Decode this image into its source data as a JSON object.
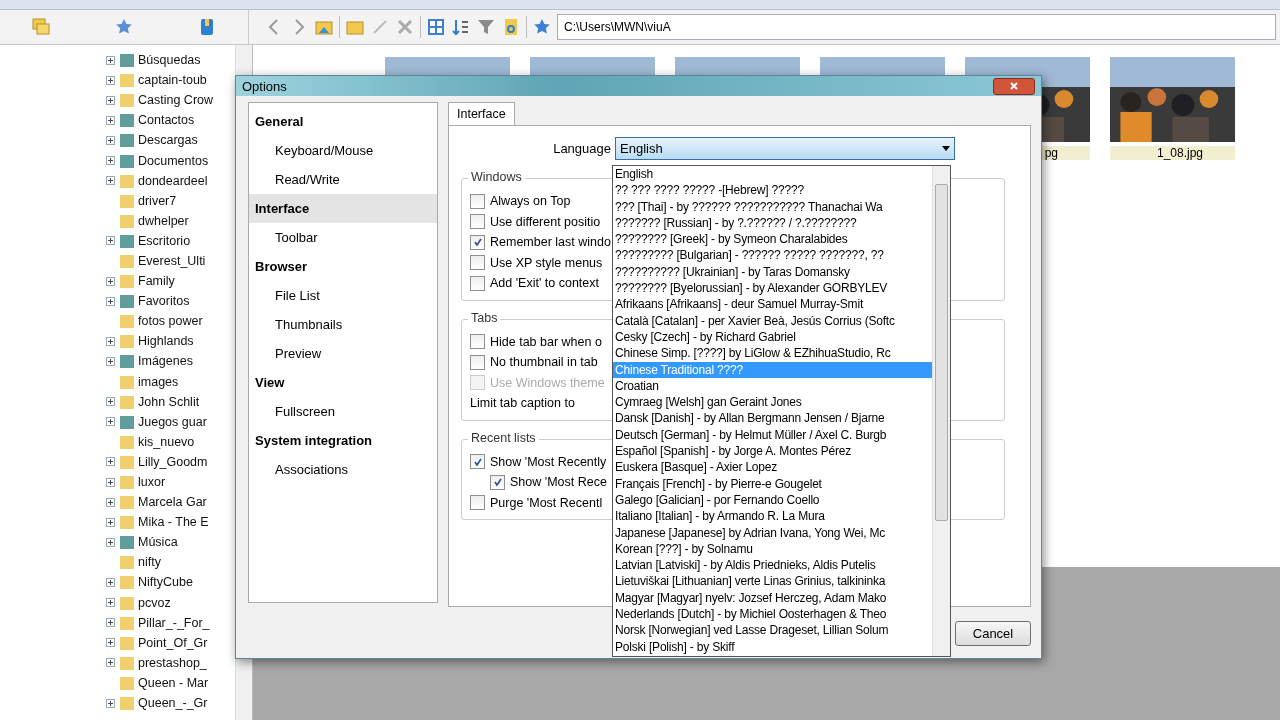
{
  "toolbar": {
    "path": "C:\\Users\\MWN\\viuA"
  },
  "tree": [
    {
      "label": "Búsquedas",
      "kind": "system",
      "expandable": true
    },
    {
      "label": "captain-toub",
      "kind": "folder",
      "expandable": true
    },
    {
      "label": "Casting Crow",
      "kind": "folder",
      "expandable": true
    },
    {
      "label": "Contactos",
      "kind": "system",
      "expandable": true
    },
    {
      "label": "Descargas",
      "kind": "system",
      "expandable": true
    },
    {
      "label": "Documentos",
      "kind": "system",
      "expandable": true
    },
    {
      "label": "dondeardeel",
      "kind": "folder",
      "expandable": true
    },
    {
      "label": "driver7",
      "kind": "folder",
      "expandable": false
    },
    {
      "label": "dwhelper",
      "kind": "folder",
      "expandable": false
    },
    {
      "label": "Escritorio",
      "kind": "system",
      "expandable": true
    },
    {
      "label": "Everest_Ulti",
      "kind": "folder",
      "expandable": false
    },
    {
      "label": "Family",
      "kind": "folder",
      "expandable": true
    },
    {
      "label": "Favoritos",
      "kind": "system",
      "expandable": true
    },
    {
      "label": "fotos power",
      "kind": "folder",
      "expandable": false
    },
    {
      "label": "Highlands",
      "kind": "folder",
      "expandable": true
    },
    {
      "label": "Imágenes",
      "kind": "system",
      "expandable": true
    },
    {
      "label": "images",
      "kind": "folder",
      "expandable": false
    },
    {
      "label": "John Schlit",
      "kind": "folder",
      "expandable": true
    },
    {
      "label": "Juegos guar",
      "kind": "system",
      "expandable": true
    },
    {
      "label": "kis_nuevo",
      "kind": "folder",
      "expandable": false
    },
    {
      "label": "Lilly_Goodm",
      "kind": "folder",
      "expandable": true
    },
    {
      "label": "luxor",
      "kind": "folder",
      "expandable": true
    },
    {
      "label": "Marcela Gar",
      "kind": "folder",
      "expandable": true
    },
    {
      "label": "Mika - The E",
      "kind": "folder",
      "expandable": true
    },
    {
      "label": "Música",
      "kind": "system",
      "expandable": true
    },
    {
      "label": "nifty",
      "kind": "folder",
      "expandable": false
    },
    {
      "label": "NiftyCube",
      "kind": "folder",
      "expandable": true
    },
    {
      "label": "pcvoz",
      "kind": "folder",
      "expandable": true
    },
    {
      "label": "Pillar_-_For_",
      "kind": "folder",
      "expandable": true
    },
    {
      "label": "Point_Of_Gr",
      "kind": "folder",
      "expandable": true
    },
    {
      "label": "prestashop_",
      "kind": "folder",
      "expandable": true
    },
    {
      "label": "Queen - Mar",
      "kind": "folder",
      "expandable": false
    },
    {
      "label": "Queen_-_Gr",
      "kind": "folder",
      "expandable": true
    }
  ],
  "thumbnails": [
    {
      "kind": "picture"
    },
    {
      "kind": "picture"
    },
    {
      "kind": "picture"
    },
    {
      "kind": "picture"
    },
    {
      "kind": "picture",
      "caption": "pg"
    },
    {
      "kind": "picture",
      "caption": "1_08.jpg"
    }
  ],
  "dialog": {
    "title": "Options",
    "nav": [
      {
        "label": "General",
        "kind": "header",
        "selected": false
      },
      {
        "label": "Keyboard/Mouse",
        "kind": "sub",
        "selected": false
      },
      {
        "label": "Read/Write",
        "kind": "sub",
        "selected": false
      },
      {
        "label": "Interface",
        "kind": "header",
        "selected": true
      },
      {
        "label": "Toolbar",
        "kind": "sub",
        "selected": false
      },
      {
        "label": "Browser",
        "kind": "header",
        "selected": false
      },
      {
        "label": "File List",
        "kind": "sub",
        "selected": false
      },
      {
        "label": "Thumbnails",
        "kind": "sub",
        "selected": false
      },
      {
        "label": "Preview",
        "kind": "sub",
        "selected": false
      },
      {
        "label": "View",
        "kind": "header",
        "selected": false
      },
      {
        "label": "Fullscreen",
        "kind": "sub",
        "selected": false
      },
      {
        "label": "System integration",
        "kind": "header",
        "selected": false
      },
      {
        "label": "Associations",
        "kind": "sub",
        "selected": false
      }
    ],
    "tab": "Interface",
    "language": {
      "label": "Language",
      "value": "English"
    },
    "groups": [
      {
        "title": "Windows",
        "rows": [
          {
            "kind": "checkbox",
            "label": "Always on Top",
            "checked": false,
            "disabled": false,
            "indented": false
          },
          {
            "kind": "checkbox",
            "label": "Use different positio",
            "checked": false,
            "disabled": false,
            "indented": false
          },
          {
            "kind": "checkbox",
            "label": "Remember last windo",
            "checked": true,
            "disabled": false,
            "indented": false
          },
          {
            "kind": "checkbox",
            "label": "Use XP style menus",
            "checked": false,
            "disabled": false,
            "indented": false
          },
          {
            "kind": "checkbox",
            "label": "Add 'Exit' to context",
            "checked": false,
            "disabled": false,
            "indented": false
          }
        ]
      },
      {
        "title": "Tabs",
        "rows": [
          {
            "kind": "checkbox",
            "label": "Hide tab bar when o",
            "checked": false,
            "disabled": false,
            "indented": false
          },
          {
            "kind": "checkbox",
            "label": "No thumbnail in tab",
            "checked": false,
            "disabled": false,
            "indented": false
          },
          {
            "kind": "checkbox",
            "label": "Use Windows theme",
            "checked": false,
            "disabled": true,
            "indented": false
          },
          {
            "kind": "label",
            "label": "Limit tab caption to"
          }
        ]
      },
      {
        "title": "Recent lists",
        "rows": [
          {
            "kind": "checkbox",
            "label": "Show 'Most Recently",
            "checked": true,
            "disabled": false,
            "indented": false
          },
          {
            "kind": "checkbox",
            "label": "Show 'Most Rece",
            "checked": true,
            "disabled": false,
            "indented": true
          },
          {
            "kind": "checkbox",
            "label": "Purge 'Most Recentl",
            "checked": false,
            "disabled": false,
            "indented": false
          }
        ]
      }
    ],
    "cancel": "Cancel",
    "languages": [
      {
        "label": "English",
        "selected": false
      },
      {
        "label": "?? ??? ???? ?????  -[Hebrew] ?????",
        "selected": false
      },
      {
        "label": "??? [Thai] - by ?????? ??????????? Thanachai Wa",
        "selected": false
      },
      {
        "label": "??????? [Russian] - by ?.?????? / ?.????????",
        "selected": false
      },
      {
        "label": "???????? [Greek] - by Symeon Charalabides",
        "selected": false
      },
      {
        "label": "????????? [Bulgarian] - ?????? ????? ???????, ??",
        "selected": false
      },
      {
        "label": "?????????? [Ukrainian] - by Taras Domansky",
        "selected": false
      },
      {
        "label": "???????? [Byelorussian] - by Alexander GORBYLEV",
        "selected": false
      },
      {
        "label": "Afrikaans [Afrikaans] - deur Samuel Murray-Smit",
        "selected": false
      },
      {
        "label": "Català [Catalan] - per Xavier Beà, Jesús Corrius (Softc",
        "selected": false
      },
      {
        "label": "Cesky [Czech] - by Richard Gabriel",
        "selected": false
      },
      {
        "label": "Chinese Simp. [????] by LiGlow & EZhihuaStudio, Rc",
        "selected": false
      },
      {
        "label": "Chinese Traditional ????",
        "selected": true
      },
      {
        "label": "Croatian",
        "selected": false
      },
      {
        "label": "Cymraeg [Welsh] gan Geraint Jones",
        "selected": false
      },
      {
        "label": "Dansk [Danish] - by Allan Bergmann Jensen / Bjarne",
        "selected": false
      },
      {
        "label": "Deutsch [German] - by Helmut Müller / Axel C. Burgb",
        "selected": false
      },
      {
        "label": "Español [Spanish] - by Jorge A. Montes Pérez",
        "selected": false
      },
      {
        "label": "Euskera [Basque] - Axier Lopez",
        "selected": false
      },
      {
        "label": "Français [French] - by Pierre-e Gougelet",
        "selected": false
      },
      {
        "label": "Galego [Galician] - por Fernando Coello",
        "selected": false
      },
      {
        "label": "Italiano [Italian] - by Armando R. La Mura",
        "selected": false
      },
      {
        "label": "Japanese [Japanese] by Adrian Ivana, Yong Wei, Mc",
        "selected": false
      },
      {
        "label": "Korean [???] - by Solnamu",
        "selected": false
      },
      {
        "label": "Latvian [Latviski] - by Aldis Priednieks, Aldis Putelis",
        "selected": false
      },
      {
        "label": "Lietuviškai [Lithuanian] verte Linas Grinius, talkininka",
        "selected": false
      },
      {
        "label": "Magyar [Magyar] nyelv: Jozsef Herczeg, Adam Mako",
        "selected": false
      },
      {
        "label": "Nederlands [Dutch] - by Michiel Oosterhagen & Theo",
        "selected": false
      },
      {
        "label": "Norsk [Norwegian] ved Lasse Drageset, Lillian Solum",
        "selected": false
      },
      {
        "label": "Polski [Polish] - by Skiff",
        "selected": false
      }
    ]
  }
}
